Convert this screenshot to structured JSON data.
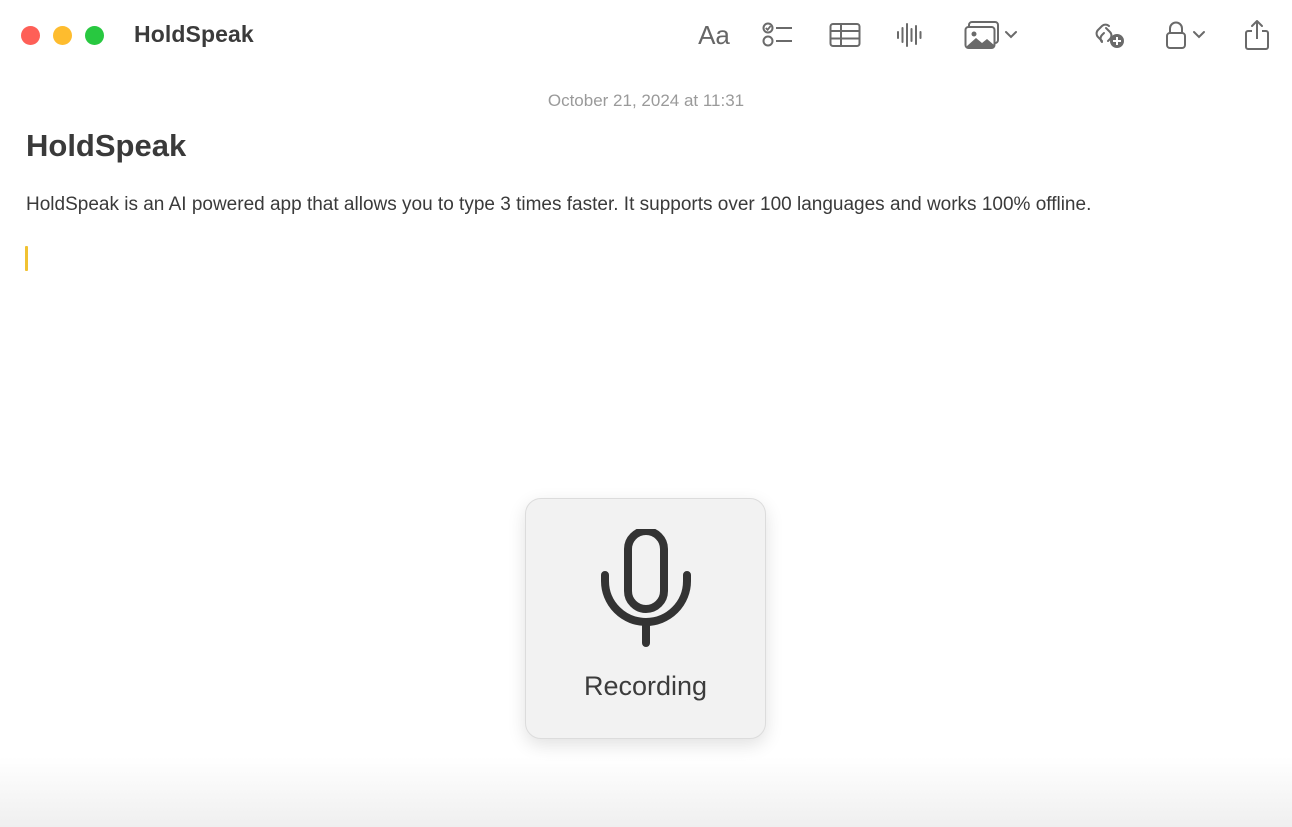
{
  "window": {
    "title": "HoldSpeak"
  },
  "toolbar": {
    "format_label": "Aa",
    "icons": [
      "format-icon",
      "checklist-icon",
      "table-icon",
      "audio-waveform-icon",
      "media-icon",
      "collaborate-icon",
      "lock-icon",
      "share-icon"
    ]
  },
  "note": {
    "date": "October 21, 2024 at 11:31",
    "title": "HoldSpeak",
    "body": "HoldSpeak is an AI powered app that allows you to type 3 times faster. It supports over 100 languages and works 100% offline."
  },
  "recording": {
    "label": "Recording",
    "icon": "microphone-icon"
  },
  "colors": {
    "close": "#fe5f57",
    "minimize": "#febc2e",
    "maximize": "#28c840",
    "caret": "#f1c232"
  }
}
